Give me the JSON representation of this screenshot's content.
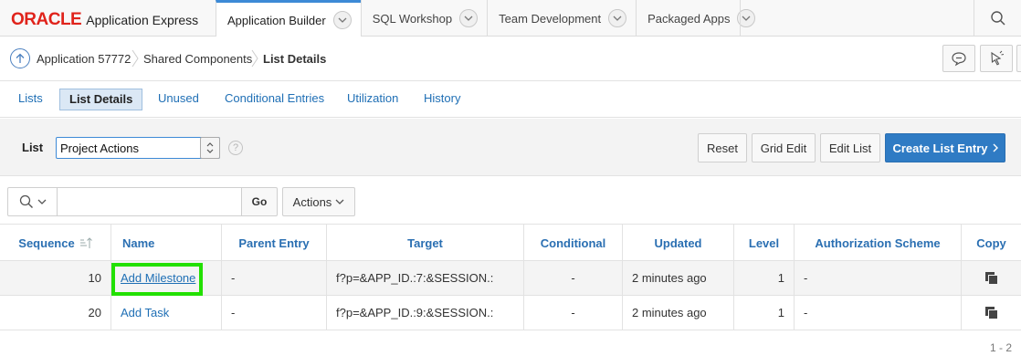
{
  "brand": {
    "oracle": "ORACLE",
    "product": "Application Express"
  },
  "top_tabs": [
    {
      "label": "Application Builder"
    },
    {
      "label": "SQL Workshop"
    },
    {
      "label": "Team Development"
    },
    {
      "label": "Packaged Apps"
    }
  ],
  "breadcrumb": {
    "items": [
      "Application 57772",
      "Shared Components",
      "List Details"
    ]
  },
  "sub_tabs": [
    "Lists",
    "List Details",
    "Unused",
    "Conditional Entries",
    "Utilization",
    "History"
  ],
  "list_toolbar": {
    "label": "List",
    "selected_list": "Project Actions",
    "help": "?",
    "buttons": {
      "reset": "Reset",
      "grid_edit": "Grid Edit",
      "edit_list": "Edit List",
      "create": "Create List Entry"
    }
  },
  "search": {
    "go": "Go",
    "actions": "Actions"
  },
  "table": {
    "columns": [
      "Sequence",
      "Name",
      "Parent Entry",
      "Target",
      "Conditional",
      "Updated",
      "Level",
      "Authorization Scheme",
      "Copy"
    ],
    "rows": [
      {
        "sequence": "10",
        "name": "Add Milestone",
        "parent": "-",
        "target": "f?p=&APP_ID.:7:&SESSION.:",
        "conditional": "-",
        "updated": "2 minutes ago",
        "level": "1",
        "auth": "-"
      },
      {
        "sequence": "20",
        "name": "Add Task",
        "parent": "-",
        "target": "f?p=&APP_ID.:9:&SESSION.:",
        "conditional": "-",
        "updated": "2 minutes ago",
        "level": "1",
        "auth": "-"
      }
    ]
  },
  "pagination": "1 - 2",
  "colors": {
    "accent": "#2f7bc4",
    "link": "#1f6fb5",
    "oracle_red": "#e0231b",
    "highlight": "#22e000"
  }
}
